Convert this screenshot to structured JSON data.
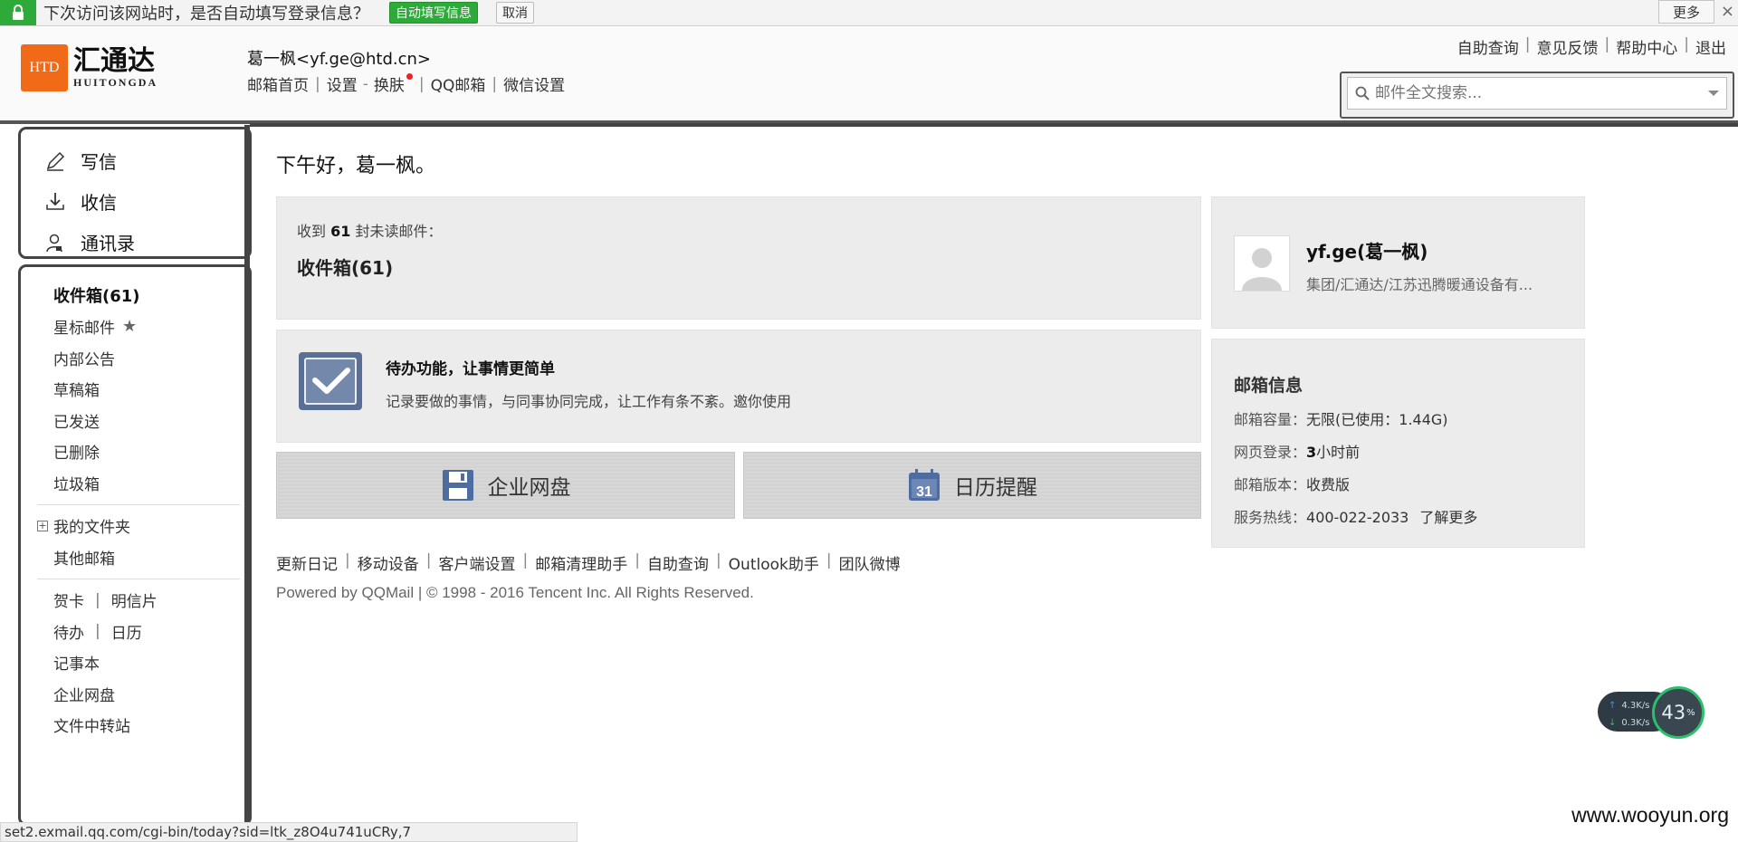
{
  "autofill": {
    "message": "下次访问该网站时，是否自动填写登录信息？",
    "fill_button": "自动填写信息",
    "cancel_button": "取消",
    "more_button": "更多",
    "close": "×"
  },
  "logo": {
    "box": "HTD",
    "cn": "汇通达",
    "en": "HUITONGDA"
  },
  "user": {
    "display": "葛一枫<yf.ge@htd.cn>",
    "nav": [
      "邮箱首页",
      "设置",
      "换肤",
      "QQ邮箱",
      "微信设置"
    ]
  },
  "top_links": [
    "自助查询",
    "意见反馈",
    "帮助中心",
    "退出"
  ],
  "search": {
    "placeholder": "邮件全文搜索..."
  },
  "actions": [
    "写信",
    "收信",
    "通讯录"
  ],
  "folders": {
    "inbox": "收件箱(61)",
    "starred": "星标邮件",
    "notice": "内部公告",
    "drafts": "草稿箱",
    "sent": "已发送",
    "deleted": "已删除",
    "spam": "垃圾箱",
    "my_folders": "我的文件夹",
    "other": "其他邮箱",
    "greeting_card": "贺卡",
    "postcard": "明信片",
    "todo": "待办",
    "calendar": "日历",
    "notebook": "记事本",
    "netdisk": "企业网盘",
    "transfer": "文件中转站"
  },
  "main": {
    "greeting": "下午好，葛一枫。",
    "unread_prefix": "收到",
    "unread_count": "61",
    "unread_suffix": "封未读邮件：",
    "unread_box": "收件箱(61)",
    "todo_title": "待办功能，让事情更简单",
    "todo_desc": "记录要做的事情，与同事协同完成，让工作有条不紊。邀你使用",
    "tile_disk": "企业网盘",
    "tile_calendar": "日历提醒",
    "calendar_day": "31"
  },
  "footer": {
    "links": [
      "更新日记",
      "移动设备",
      "客户端设置",
      "邮箱清理助手",
      "自助查询",
      "Outlook助手",
      "团队微博"
    ],
    "copyright": "Powered by QQMail  | © 1998 - 2016 Tencent Inc. All Rights Reserved."
  },
  "profile": {
    "name": "yf.ge(葛一枫)",
    "org": "集团/汇通达/江苏迅腾暖通设备有..."
  },
  "mail_info": {
    "title": "邮箱信息",
    "capacity_label": "邮箱容量：",
    "capacity_value": "无限(已使用：1.44G)",
    "login_label": "网页登录：",
    "login_num": "3",
    "login_unit": "小时前",
    "version_label": "邮箱版本：",
    "version_value": "收费版",
    "hotline_label": "服务热线：",
    "hotline_value": "400-022-2033",
    "learn_more": "了解更多"
  },
  "speed": {
    "up": "4.3K/s",
    "down": "0.3K/s",
    "percent": "43",
    "percent_unit": "%"
  },
  "status_url": "set2.exmail.qq.com/cgi-bin/today?sid=ltk_z8O4u741uCRy,7",
  "watermark": "www.wooyun.org",
  "colors": {
    "green": "#2eaa3a",
    "logo_orange": "#f06a17",
    "panel_bg": "#ececec"
  }
}
